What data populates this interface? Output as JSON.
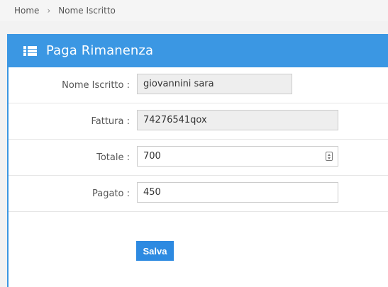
{
  "breadcrumb": {
    "home": "Home",
    "separator": "›",
    "current": "Nome Iscritto"
  },
  "panel": {
    "title": "Paga Rimanenza",
    "icon": "list-icon",
    "accent_color": "#3b97e3"
  },
  "form": {
    "nome": {
      "label": "Nome Iscritto :",
      "value": "giovannini sara"
    },
    "fattura": {
      "label": "Fattura :",
      "value": "74276541qox"
    },
    "totale": {
      "label": "Totale :",
      "value": "700"
    },
    "pagato": {
      "label": "Pagato :",
      "value": "450"
    },
    "submit_label": "Salva"
  }
}
